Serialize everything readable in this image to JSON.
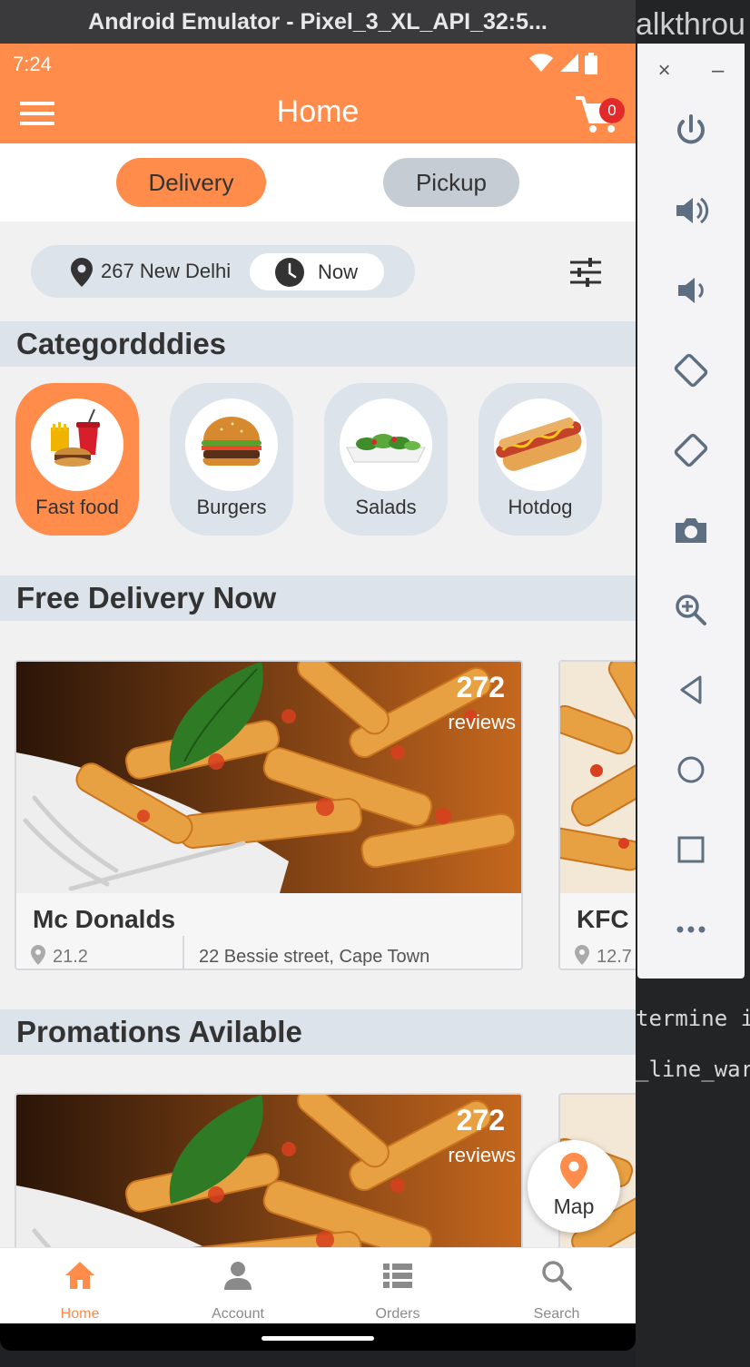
{
  "window": {
    "title": "Android Emulator - Pixel_3_XL_API_32:5..."
  },
  "background": {
    "tab_text": "alkthrou",
    "terminal_line_1": "termine if",
    "terminal_line_2": "_line_warn"
  },
  "emulator_toolbar": {
    "close_label": "×",
    "minimize_label": "–",
    "buttons": [
      "power-icon",
      "volume-up-icon",
      "volume-down-icon",
      "rotate-left-icon",
      "rotate-right-icon",
      "camera-icon",
      "zoom-icon",
      "back-icon",
      "home-icon",
      "overview-icon",
      "more-icon"
    ]
  },
  "status_bar": {
    "time": "7:24"
  },
  "app_bar": {
    "title": "Home",
    "cart_count": "0"
  },
  "mode_toggle": {
    "delivery": "Delivery",
    "pickup": "Pickup",
    "selected": "Delivery"
  },
  "location": {
    "address": "267 New Delhi",
    "time": "Now"
  },
  "sections": {
    "categories": "Categordddies",
    "free_delivery": "Free Delivery Now",
    "promotions": "Promations Avilable"
  },
  "categories": [
    {
      "label": "Fast food",
      "active": true
    },
    {
      "label": "Burgers",
      "active": false
    },
    {
      "label": "Salads",
      "active": false
    },
    {
      "label": "Hotdog",
      "active": false
    }
  ],
  "free_delivery": [
    {
      "name": "Mc Donalds",
      "reviews": "272",
      "reviews_label": "reviews",
      "distance": "21.2",
      "address": "22 Bessie street, Cape Town"
    },
    {
      "name": "KFC",
      "distance": "12.7"
    }
  ],
  "promotions": [
    {
      "reviews": "272",
      "reviews_label": "reviews"
    }
  ],
  "map_button": {
    "label": "Map"
  },
  "bottom_nav": [
    {
      "label": "Home",
      "icon": "home-icon",
      "active": true
    },
    {
      "label": "Account",
      "icon": "account-icon",
      "active": false
    },
    {
      "label": "Orders",
      "icon": "orders-icon",
      "active": false
    },
    {
      "label": "Search",
      "icon": "search-icon",
      "active": false
    }
  ],
  "colors": {
    "accent": "#ff8c4b",
    "badge": "#e32a2a",
    "section_bg": "#dde3ea"
  }
}
